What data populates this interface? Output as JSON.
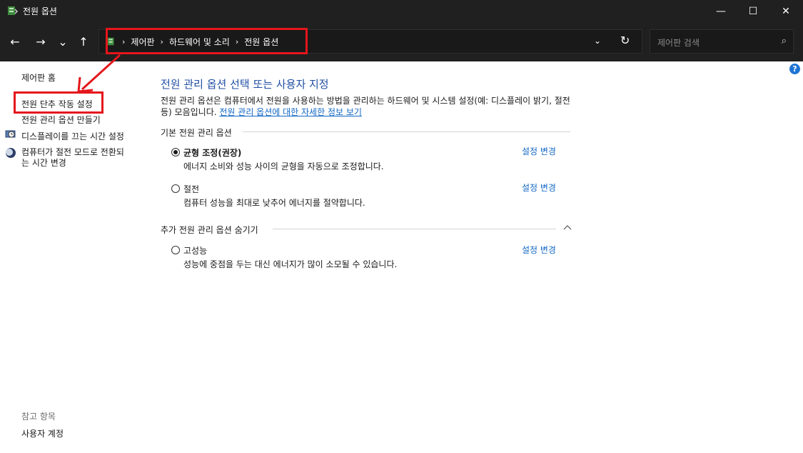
{
  "window": {
    "title": "전원 옵션",
    "minimize": "—",
    "maximize": "☐",
    "close": "✕"
  },
  "nav": {
    "back": "←",
    "forward": "→",
    "recent": "⌄",
    "up": "↑"
  },
  "address": {
    "crumbs": [
      "제어판",
      "하드웨어 및 소리",
      "전원 옵션"
    ],
    "separator": "›",
    "dropdown": "⌄",
    "refresh": "↻"
  },
  "search": {
    "placeholder": "제어판 검색",
    "icon": "⌕"
  },
  "sidebar": {
    "items": [
      {
        "label": "제어판 홈"
      },
      {
        "label": "전원 단추 작동 설정"
      },
      {
        "label": "전원 관리 옵션 만들기"
      },
      {
        "label": "디스플레이를 끄는 시간 설정"
      },
      {
        "label": "컴퓨터가 절전 모드로 전환되\n는 시간 변경"
      }
    ],
    "see_also_heading": "참고 항목",
    "see_also_items": [
      {
        "label": "사용자 계정"
      }
    ]
  },
  "main": {
    "title": "전원 관리 옵션 선택 또는 사용자 지정",
    "description": "전원 관리 옵션은 컴퓨터에서 전원을 사용하는 방법을 관리하는 하드웨어 및 시스템 설정(예: 디스플레이 밝기, 절전 등) 모음입니다.",
    "more_info_link": "전원 관리 옵션에 대한 자세한 정보 보기",
    "basic_heading": "기본 전원 관리 옵션",
    "extra_heading": "추가 전원 관리 옵션 숨기기",
    "change_label": "설정 변경",
    "plans": [
      {
        "name": "균형 조정(권장)",
        "desc": "에너지 소비와 성능 사이의 균형을 자동으로 조정합니다.",
        "selected": true
      },
      {
        "name": "절전",
        "desc": "컴퓨터 성능을 최대로 낮추어 에너지를 절약합니다.",
        "selected": false
      },
      {
        "name": "고성능",
        "desc": "성능에 중점을 두는 대신 에너지가 많이 소모될 수 있습니다.",
        "selected": false
      }
    ]
  },
  "help": "?",
  "colors": {
    "annotation_red": "#e4161b",
    "link_blue": "#1267c4",
    "title_blue": "#1f4ea3"
  }
}
